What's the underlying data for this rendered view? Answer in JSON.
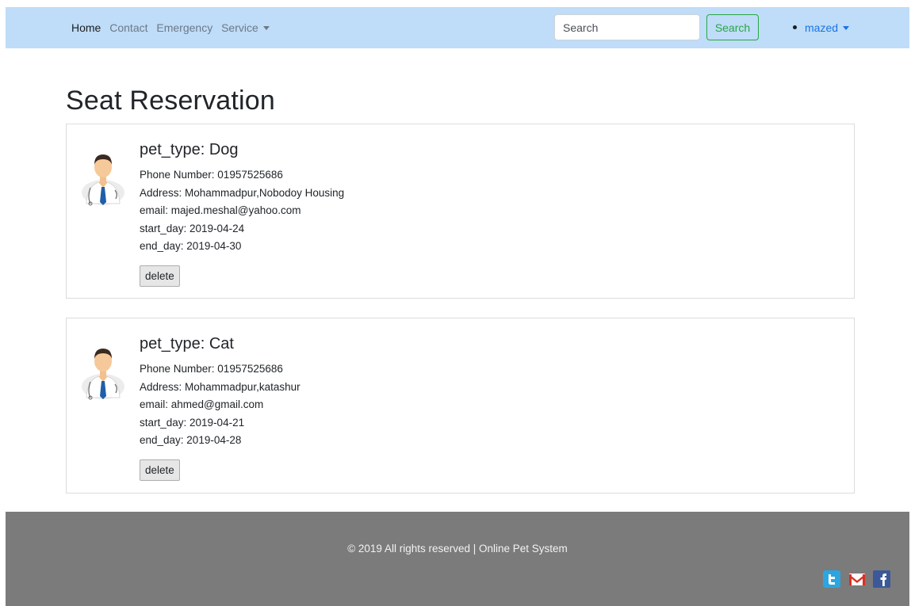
{
  "nav": {
    "links": [
      "Home",
      "Contact",
      "Emergency"
    ],
    "service_label": "Service",
    "search_placeholder": "Search",
    "search_button": "Search",
    "user": "mazed"
  },
  "page": {
    "title": "Seat Reservation"
  },
  "reservations": [
    {
      "pet_type": "pet_type: Dog",
      "phone": "Phone Number: 01957525686",
      "address": "Address: Mohammadpur,Nobodoy Housing",
      "email": "email: majed.meshal@yahoo.com",
      "start_day": "start_day: 2019-04-24",
      "end_day": "end_day: 2019-04-30",
      "delete_label": "delete"
    },
    {
      "pet_type": "pet_type: Cat",
      "phone": "Phone Number: 01957525686",
      "address": "Address: Mohammadpur,katashur",
      "email": "email: ahmed@gmail.com",
      "start_day": "start_day: 2019-04-21",
      "end_day": "end_day: 2019-04-28",
      "delete_label": "delete"
    }
  ],
  "footer": {
    "copyright": "© 2019 All rights reserved | Online Pet System",
    "social_icons": [
      "twitter-icon",
      "gmail-icon",
      "facebook-icon"
    ]
  },
  "colors": {
    "navbar_bg": "#bfdcf8",
    "success": "#28a745",
    "link": "#1a73e8",
    "footer_bg": "#7b7b7b"
  }
}
